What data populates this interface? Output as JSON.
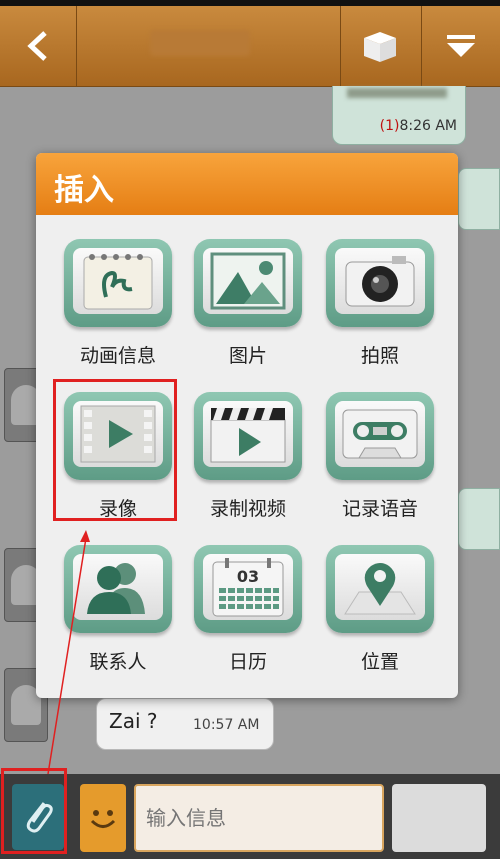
{
  "header": {
    "back_icon": "back-chevron-icon",
    "right_icons": [
      "box-icon",
      "dropdown-icon"
    ]
  },
  "chat": {
    "outgoing": {
      "unread_mark": "(1)",
      "time": "8:26 AM"
    },
    "incoming": {
      "text": "Zai ?",
      "time": "10:57 AM"
    }
  },
  "dialog": {
    "title": "插入",
    "items": [
      {
        "label": "动画信息",
        "icon": "animation-note-icon"
      },
      {
        "label": "图片",
        "icon": "picture-icon"
      },
      {
        "label": "拍照",
        "icon": "camera-icon"
      },
      {
        "label": "录像",
        "icon": "video-record-icon"
      },
      {
        "label": "录制视频",
        "icon": "clapperboard-icon"
      },
      {
        "label": "记录语音",
        "icon": "cassette-icon"
      },
      {
        "label": "联系人",
        "icon": "contacts-icon"
      },
      {
        "label": "日历",
        "icon": "calendar-icon",
        "calendar_day": "03"
      },
      {
        "label": "位置",
        "icon": "location-pin-icon"
      }
    ]
  },
  "composer": {
    "placeholder": "输入信息",
    "attach_icon": "paperclip-icon",
    "emoji_icon": "smiley-icon"
  },
  "colors": {
    "header": "#b87430",
    "dialog_header": "#f29a2e",
    "tile": "#78b29c",
    "annotation": "#e02020"
  }
}
